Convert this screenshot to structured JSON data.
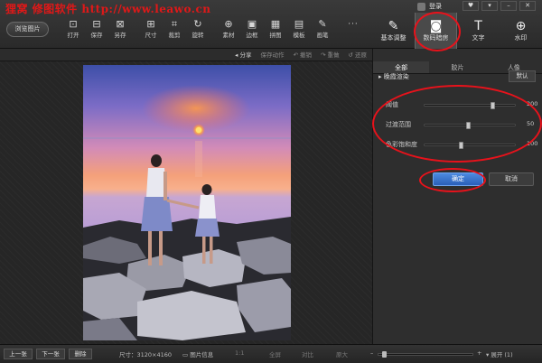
{
  "app": {
    "brand": "狸窝  修图软件   http://www.leawo.cn",
    "login": "登录",
    "window_controls": [
      "♥",
      "▾",
      "–",
      "✕"
    ]
  },
  "toolbar": {
    "browse_label": "浏览图片",
    "tools": [
      {
        "icon": "open-icon",
        "glyph": "⊡",
        "label": "打开"
      },
      {
        "icon": "save-icon",
        "glyph": "⊟",
        "label": "保存"
      },
      {
        "icon": "save-as-icon",
        "glyph": "⊠",
        "label": "另存"
      },
      {
        "icon": "size-icon",
        "glyph": "⊞",
        "label": "尺寸"
      },
      {
        "icon": "crop-icon",
        "glyph": "⌗",
        "label": "裁剪"
      },
      {
        "icon": "rotate-icon",
        "glyph": "↻",
        "label": "旋转"
      },
      {
        "icon": "material-icon",
        "glyph": "⊕",
        "label": "素材"
      },
      {
        "icon": "border-icon",
        "glyph": "▣",
        "label": "边框"
      },
      {
        "icon": "collage-icon",
        "glyph": "▦",
        "label": "拼图"
      },
      {
        "icon": "template-icon",
        "glyph": "▤",
        "label": "模板"
      },
      {
        "icon": "brush-icon",
        "glyph": "✎",
        "label": "画笔"
      },
      {
        "icon": "more-icon",
        "glyph": "···",
        "label": ""
      }
    ]
  },
  "right_tabs": [
    {
      "icon": "basic-adjust-icon",
      "glyph": "✎",
      "label": "基本调整"
    },
    {
      "icon": "camera-icon",
      "glyph": "◙",
      "label": "数码暗房"
    },
    {
      "icon": "text-icon",
      "glyph": "T",
      "label": "文字"
    },
    {
      "icon": "watermark-icon",
      "glyph": "⊕",
      "label": "水印"
    }
  ],
  "actions": [
    {
      "label": "◂ 分享",
      "enabled": true
    },
    {
      "label": "保存动作",
      "enabled": false
    },
    {
      "label": "↶ 撤销",
      "enabled": false
    },
    {
      "label": "↷ 重做",
      "enabled": false
    },
    {
      "label": "↺ 还原",
      "enabled": false
    }
  ],
  "panel": {
    "tabs": [
      "全部",
      "胶片",
      "人像"
    ],
    "effect_title": "▸ 晚霞渲染",
    "default_label": "默认",
    "sliders": [
      {
        "label": "阈值",
        "value": 200,
        "fraction": 0.73
      },
      {
        "label": "过渡范围",
        "value": 50,
        "fraction": 0.46
      },
      {
        "label": "色彩饱和度",
        "value": 100,
        "fraction": 0.38
      }
    ],
    "ok_label": "确定",
    "cancel_label": "取消"
  },
  "status": {
    "prev": "上一张",
    "next": "下一张",
    "delete": "删除",
    "size": "尺寸：3120×4160",
    "info": "图片信息",
    "ratio": "1:1",
    "fullscreen": "全屏",
    "compare": "对比",
    "original": "原大",
    "zoom_fraction": 0.04,
    "expand": "▾ 展开 (1)"
  },
  "colors": {
    "annotation": "#e8121b",
    "accent": "#3a74d2",
    "brand": "#e01818"
  }
}
